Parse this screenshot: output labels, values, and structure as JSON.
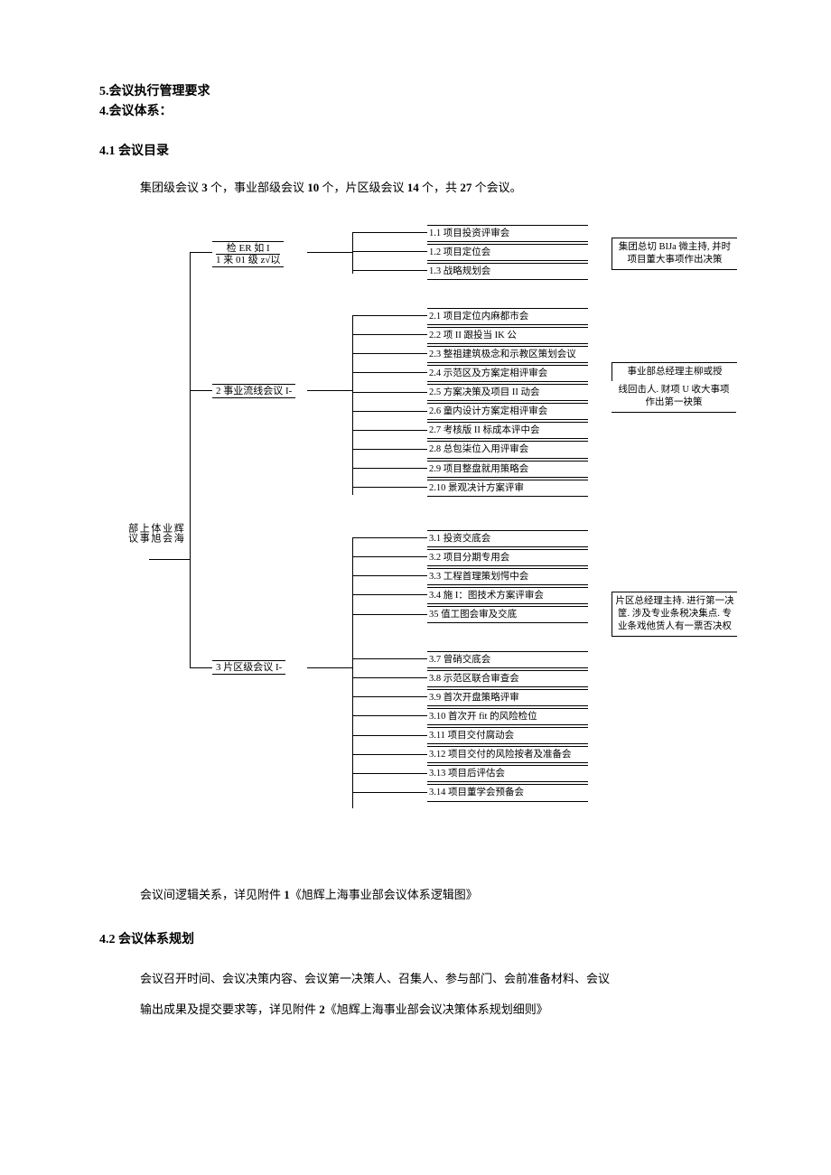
{
  "title_5": "5.会议执行管理要求",
  "title_4": "4.会议体系：",
  "sec_4_1": "4.1 会议目录",
  "intro_prefix": "集团级会议 ",
  "intro_n1": "3",
  "intro_mid1": " 个，事业部级会议 ",
  "intro_n2": "10",
  "intro_mid2": " 个，片区级会议 ",
  "intro_n3": "14",
  "intro_mid3": " 个，共 ",
  "intro_n4": "27",
  "intro_suffix": " 个会议。",
  "vlabel_line1": "辉海",
  "vlabel_line2": "业会",
  "vlabel_line3": "体旭",
  "vlabel_line4": "上事",
  "vlabel_line5": "部议",
  "mid_1a": "检 ER 如     I",
  "mid_1b": "1 来 01 级 z√以",
  "mid_2": "2 事业流线会议 I-",
  "mid_3": "3 片区级会议 I-",
  "g1": {
    "items": [
      "1.1 项目投资评审会",
      "1.2 项目定位会",
      "1.3 战略规划会"
    ],
    "side": "集团总切 BIJa 微主持, 并时项目董大事项作出决策"
  },
  "g2": {
    "items": [
      "2.1 项目定位内麻都市会",
      "2.2 项 II 跟投当 IK 公",
      "2.3 整祖建筑极念和示教区策划会议",
      "2.4 示范区及方案定相评审会",
      "2.5 方案决策及项目 II 动会",
      "2.6 童内设计方案定相评审会",
      "2.7 考核版 II 标成本评中会",
      "2.8 总包柒位入用评审会",
      "2.9 项目整盘就用策略会",
      "2.10 景观决计方案评审"
    ],
    "side": "事业部总经理主柳或授",
    "side2": "线回击人. 财项 U 收大事项作出第一袂策"
  },
  "g3": {
    "items_a": [
      "3.1 投资交底会",
      "3.2 项目分期专用会",
      "3.3 工程首理策划愕中会",
      "3.4 施 I：图技术方案评审会",
      "35 值工图会审及交底"
    ],
    "items_b": [
      "3.7 曾硝交底会",
      "3.8 示范区联合审查会",
      "3.9 首次开盘策略评审",
      "3.10 首次开 fit 的风险检位",
      "3.11 项目交付腐动会",
      "3.12 项目交付的风险按者及准备会",
      "3.13 项目后评估会",
      "3.14 项目董学会预备会"
    ],
    "side": "片区总经理主持. 进行第一决筐. 涉及专业条税决集点. 专业条戏他赁人有一票否决权"
  },
  "note_line": "会议间逻辑关系，详见附件 ",
  "note_num": "1",
  "note_suffix": "《旭辉上海事业部会议体系逻辑图》",
  "sec_4_2": "4.2 会议体系规划",
  "para_4_2_a": "会议召开时间、会议决策内容、会议第一决策人、召集人、参与部门、会前准备材料、会议",
  "para_4_2_b": "输出成果及提交要求等，详见附件 ",
  "para_4_2_num": "2",
  "para_4_2_suffix": "《旭辉上海事业部会议决策体系规划细则》"
}
